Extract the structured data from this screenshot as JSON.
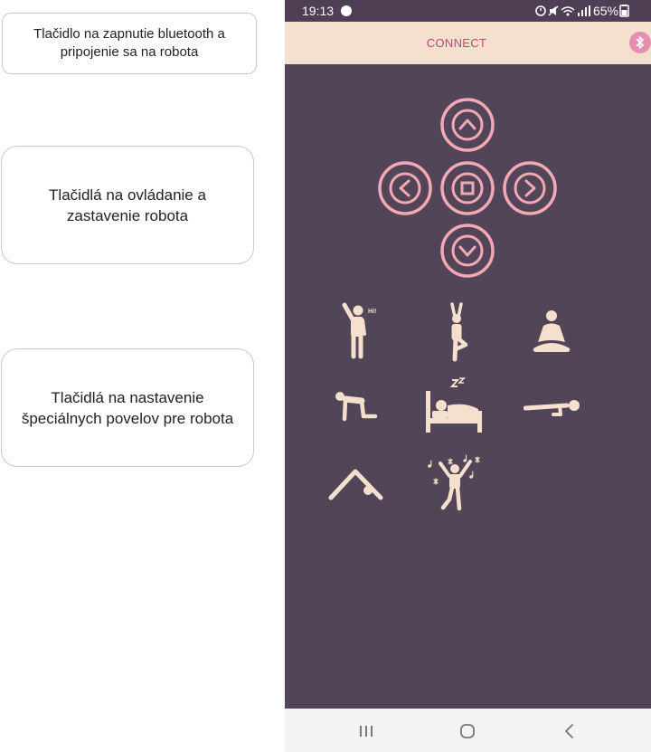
{
  "callouts": {
    "connect": "Tlačidlo na zapnutie bluetooth a\npripojenie sa na robota",
    "control": "Tlačidlá na ovládanie a\nzastavenie robota",
    "special": "Tlačidlá na nastavenie\nšpeciálnych povelov pre robota"
  },
  "status_bar": {
    "time": "19:13",
    "battery": "65%",
    "icons": [
      "messenger-icon",
      "alarm-icon",
      "mute-icon",
      "wifi-icon",
      "signal-icon",
      "battery-icon"
    ]
  },
  "app_bar": {
    "connect_label": "CONNECT",
    "icon": "bluetooth-icon"
  },
  "direction_pad": [
    "up",
    "left",
    "stop",
    "right",
    "down"
  ],
  "commands": [
    {
      "name": "hello",
      "badge": "Hi!"
    },
    {
      "name": "tree-pose"
    },
    {
      "name": "meditate"
    },
    {
      "name": "crawl"
    },
    {
      "name": "sleep",
      "badge": "Z z"
    },
    {
      "name": "pushup"
    },
    {
      "name": "bend-down"
    },
    {
      "name": "dance"
    }
  ],
  "nav_bar": [
    "recents-button",
    "home-button",
    "back-button"
  ],
  "colors": {
    "background": "#524557",
    "status_bar": "#4f3f55",
    "app_bar": "#f5e0cd",
    "accent": "#d33a7c",
    "control_stroke": "#f2a9b5",
    "icon_fill": "#f5e0cd"
  }
}
